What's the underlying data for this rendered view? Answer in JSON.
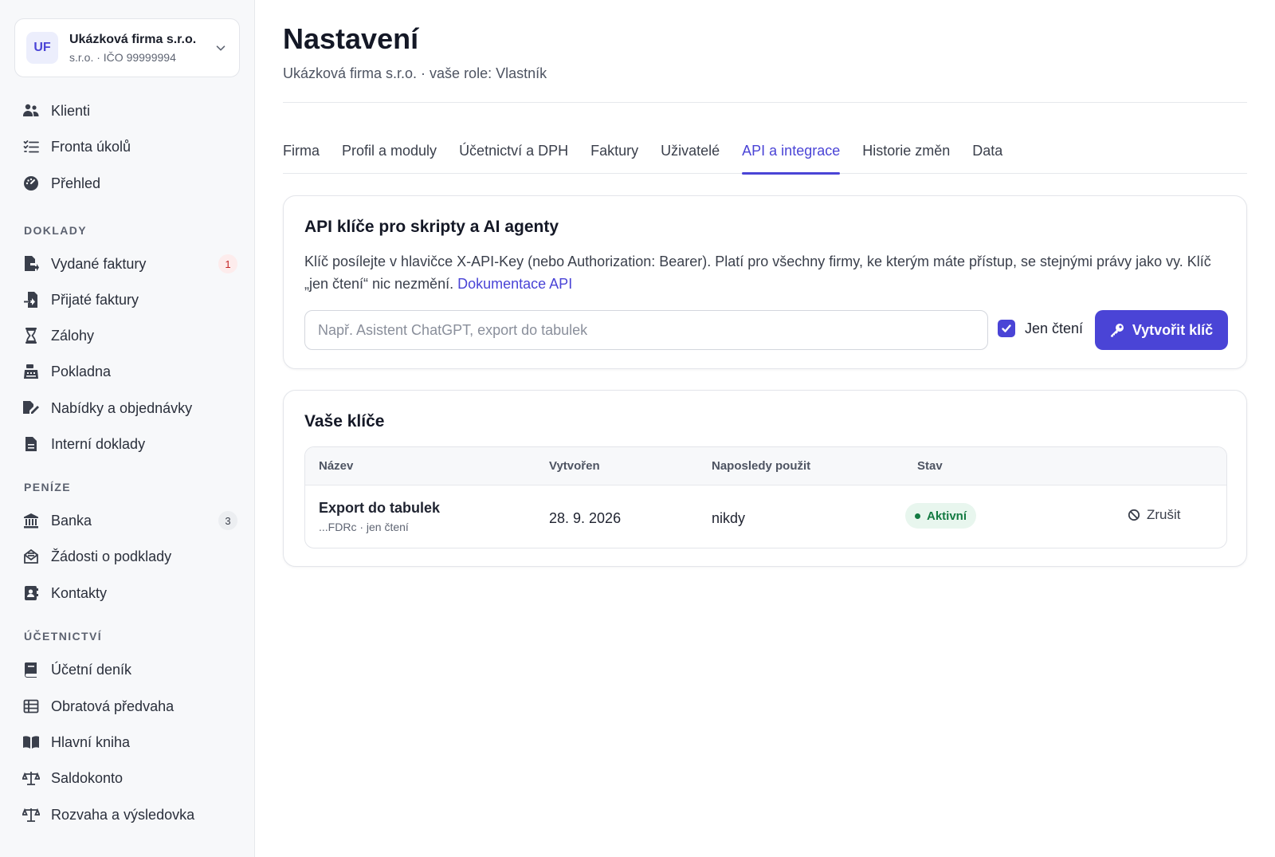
{
  "company": {
    "initials": "UF",
    "name": "Ukázková firma s.r.o.",
    "details": "s.r.o. · IČO 99999994"
  },
  "sidebar": {
    "top_items": [
      {
        "label": "Klienti",
        "icon": "users-icon"
      },
      {
        "label": "Fronta úkolů",
        "icon": "task-list-icon"
      },
      {
        "label": "Přehled",
        "icon": "dashboard-icon"
      }
    ],
    "sections": [
      {
        "title": "DOKLADY",
        "items": [
          {
            "label": "Vydané faktury",
            "icon": "file-export-icon",
            "badge": "1"
          },
          {
            "label": "Přijaté faktury",
            "icon": "file-import-icon"
          },
          {
            "label": "Zálohy",
            "icon": "hourglass-icon"
          },
          {
            "label": "Pokladna",
            "icon": "cash-register-icon"
          },
          {
            "label": "Nabídky a objednávky",
            "icon": "file-signature-icon"
          },
          {
            "label": "Interní doklady",
            "icon": "document-icon"
          }
        ]
      },
      {
        "title": "PENÍZE",
        "items": [
          {
            "label": "Banka",
            "icon": "bank-icon",
            "badge": "3"
          },
          {
            "label": "Žádosti o podklady",
            "icon": "envelope-open-icon"
          },
          {
            "label": "Kontakty",
            "icon": "address-book-icon"
          }
        ]
      },
      {
        "title": "ÚČETNICTVÍ",
        "items": [
          {
            "label": "Účetní deník",
            "icon": "journal-icon"
          },
          {
            "label": "Obratová předvaha",
            "icon": "table-icon"
          },
          {
            "label": "Hlavní kniha",
            "icon": "book-open-icon"
          },
          {
            "label": "Saldokonto",
            "icon": "scale-icon"
          },
          {
            "label": "Rozvaha a výsledovka",
            "icon": "balance-icon"
          }
        ]
      }
    ]
  },
  "header": {
    "title": "Nastavení",
    "subtitle": "Ukázková firma s.r.o. · vaše role: Vlastník"
  },
  "tabs": [
    {
      "label": "Firma",
      "active": false
    },
    {
      "label": "Profil a moduly",
      "active": false
    },
    {
      "label": "Účetnictví a DPH",
      "active": false
    },
    {
      "label": "Faktury",
      "active": false
    },
    {
      "label": "Uživatelé",
      "active": false
    },
    {
      "label": "API a integrace",
      "active": true
    },
    {
      "label": "Historie změn",
      "active": false
    },
    {
      "label": "Data",
      "active": false
    }
  ],
  "api_card": {
    "title": "API klíče pro skripty a AI agenty",
    "description": "Klíč posílejte v hlavičce X-API-Key (nebo Authorization: Bearer). Platí pro všechny firmy, ke kterým máte přístup, se stejnými právy jako vy. Klíč „jen čtení“ nic nezmění.",
    "docs_link": "Dokumentace API",
    "input_value": "",
    "input_placeholder": "Např. Asistent ChatGPT, export do tabulek",
    "readonly_label": "Jen čtení",
    "readonly_checked": true,
    "create_button": "Vytvořit klíč"
  },
  "keys_card": {
    "title": "Vaše klíče",
    "columns": [
      "Název",
      "Vytvořen",
      "Naposledy použit",
      "Stav"
    ],
    "rows": [
      {
        "name": "Export do tabulek",
        "meta": "...FDRc · jen čtení",
        "created": "28. 9. 2026",
        "last_used": "nikdy",
        "status": "Aktivní",
        "action": "Zrušit"
      }
    ]
  },
  "colors": {
    "accent": "#4a44d6",
    "status_active": "#137a42",
    "badge_red": "#c52626"
  }
}
